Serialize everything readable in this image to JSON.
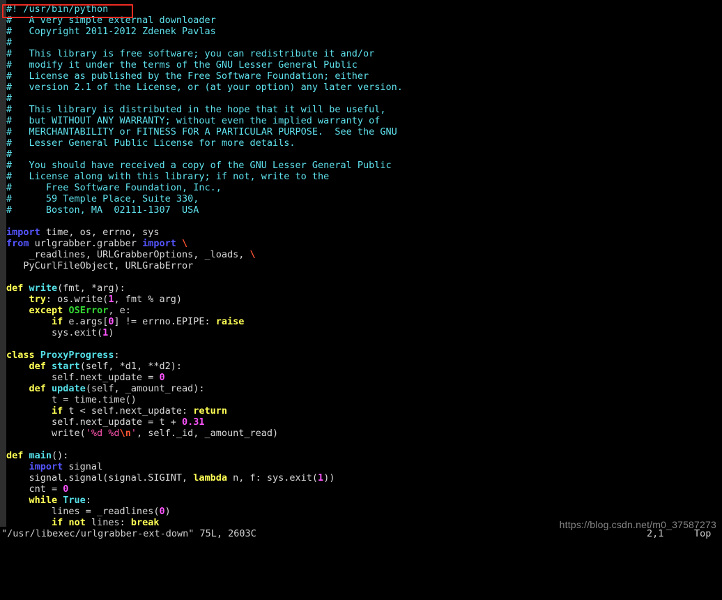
{
  "editor": {
    "name": "vim",
    "background": "#000000",
    "gutter_color": "#2e2e2e"
  },
  "annotation": {
    "shape": "rectangle",
    "color": "#ee2b22",
    "target_line": 1,
    "target_text": "#! /usr/bin/python"
  },
  "watermark": {
    "text": "https://blog.csdn.net/m0_37587273"
  },
  "statusline": {
    "file": "\"/usr/libexec/urlgrabber-ext-down\" 75L, 2603C",
    "position": "2,1",
    "scroll": "Top"
  },
  "code": {
    "lines": [
      [
        {
          "t": "#!",
          "c": "c-comment"
        },
        {
          "t": " /usr/bin/python",
          "c": "c-comment"
        }
      ],
      [
        {
          "t": "#   A very simple external downloader",
          "c": "c-comment"
        }
      ],
      [
        {
          "t": "#   Copyright 2011-2012 Zdenek Pavlas",
          "c": "c-comment"
        }
      ],
      [
        {
          "t": "#",
          "c": "c-comment"
        }
      ],
      [
        {
          "t": "#   This library is free software; you can redistribute it and/or",
          "c": "c-comment"
        }
      ],
      [
        {
          "t": "#   modify it under the terms of the GNU Lesser General Public",
          "c": "c-comment"
        }
      ],
      [
        {
          "t": "#   License as published by the Free Software Foundation; either",
          "c": "c-comment"
        }
      ],
      [
        {
          "t": "#   version 2.1 of the License, or (at your option) any later version.",
          "c": "c-comment"
        }
      ],
      [
        {
          "t": "#",
          "c": "c-comment"
        }
      ],
      [
        {
          "t": "#   This library is distributed in the hope that it will be useful,",
          "c": "c-comment"
        }
      ],
      [
        {
          "t": "#   but WITHOUT ANY WARRANTY; without even the implied warranty of",
          "c": "c-comment"
        }
      ],
      [
        {
          "t": "#   MERCHANTABILITY or FITNESS FOR A PARTICULAR PURPOSE.  See the GNU",
          "c": "c-comment"
        }
      ],
      [
        {
          "t": "#   Lesser General Public License for more details.",
          "c": "c-comment"
        }
      ],
      [
        {
          "t": "#",
          "c": "c-comment"
        }
      ],
      [
        {
          "t": "#   You should have received a copy of the GNU Lesser General Public",
          "c": "c-comment"
        }
      ],
      [
        {
          "t": "#   License along with this library; if not, write to the",
          "c": "c-comment"
        }
      ],
      [
        {
          "t": "#      Free Software Foundation, Inc.,",
          "c": "c-comment"
        }
      ],
      [
        {
          "t": "#      59 Temple Place, Suite 330,",
          "c": "c-comment"
        }
      ],
      [
        {
          "t": "#      Boston, MA  02111-1307  USA",
          "c": "c-comment"
        }
      ],
      [
        {
          "t": "",
          "c": "c-ident"
        }
      ],
      [
        {
          "t": "import",
          "c": "c-pre"
        },
        {
          "t": " time, os, errno, sys",
          "c": "c-ident"
        }
      ],
      [
        {
          "t": "from",
          "c": "c-pre"
        },
        {
          "t": " urlgrabber.grabber ",
          "c": "c-ident"
        },
        {
          "t": "import",
          "c": "c-pre"
        },
        {
          "t": " ",
          "c": "c-ident"
        },
        {
          "t": "\\",
          "c": "c-cont"
        }
      ],
      [
        {
          "t": "    _readlines, URLGrabberOptions, _loads, ",
          "c": "c-ident"
        },
        {
          "t": "\\",
          "c": "c-cont"
        }
      ],
      [
        {
          "t": "   PyCurlFileObject, URLGrabError",
          "c": "c-ident"
        }
      ],
      [
        {
          "t": "",
          "c": "c-ident"
        }
      ],
      [
        {
          "t": "def",
          "c": "c-kw"
        },
        {
          "t": " ",
          "c": "c-ident"
        },
        {
          "t": "write",
          "c": "c-func"
        },
        {
          "t": "(fmt, *arg):",
          "c": "c-ident"
        }
      ],
      [
        {
          "t": "    ",
          "c": "c-ident"
        },
        {
          "t": "try",
          "c": "c-kw"
        },
        {
          "t": ": os.write(",
          "c": "c-ident"
        },
        {
          "t": "1",
          "c": "c-num"
        },
        {
          "t": ", fmt % arg)",
          "c": "c-ident"
        }
      ],
      [
        {
          "t": "    ",
          "c": "c-ident"
        },
        {
          "t": "except",
          "c": "c-kw"
        },
        {
          "t": " ",
          "c": "c-ident"
        },
        {
          "t": "OSError",
          "c": "c-exc"
        },
        {
          "t": ", e:",
          "c": "c-ident"
        }
      ],
      [
        {
          "t": "        ",
          "c": "c-ident"
        },
        {
          "t": "if",
          "c": "c-kw"
        },
        {
          "t": " e.args[",
          "c": "c-ident"
        },
        {
          "t": "0",
          "c": "c-num"
        },
        {
          "t": "] != errno.EPIPE: ",
          "c": "c-ident"
        },
        {
          "t": "raise",
          "c": "c-kw"
        }
      ],
      [
        {
          "t": "        sys.exit(",
          "c": "c-ident"
        },
        {
          "t": "1",
          "c": "c-num"
        },
        {
          "t": ")",
          "c": "c-ident"
        }
      ],
      [
        {
          "t": "",
          "c": "c-ident"
        }
      ],
      [
        {
          "t": "class",
          "c": "c-kw"
        },
        {
          "t": " ",
          "c": "c-ident"
        },
        {
          "t": "ProxyProgress",
          "c": "c-func"
        },
        {
          "t": ":",
          "c": "c-ident"
        }
      ],
      [
        {
          "t": "    ",
          "c": "c-ident"
        },
        {
          "t": "def",
          "c": "c-kw"
        },
        {
          "t": " ",
          "c": "c-ident"
        },
        {
          "t": "start",
          "c": "c-func"
        },
        {
          "t": "(self, *d1, **d2):",
          "c": "c-ident"
        }
      ],
      [
        {
          "t": "        self.next_update = ",
          "c": "c-ident"
        },
        {
          "t": "0",
          "c": "c-num"
        }
      ],
      [
        {
          "t": "    ",
          "c": "c-ident"
        },
        {
          "t": "def",
          "c": "c-kw"
        },
        {
          "t": " ",
          "c": "c-ident"
        },
        {
          "t": "update",
          "c": "c-func"
        },
        {
          "t": "(self, _amount_read):",
          "c": "c-ident"
        }
      ],
      [
        {
          "t": "        t = time.time()",
          "c": "c-ident"
        }
      ],
      [
        {
          "t": "        ",
          "c": "c-ident"
        },
        {
          "t": "if",
          "c": "c-kw"
        },
        {
          "t": " t < self.next_update: ",
          "c": "c-ident"
        },
        {
          "t": "return",
          "c": "c-kw"
        }
      ],
      [
        {
          "t": "        self.next_update = t + ",
          "c": "c-ident"
        },
        {
          "t": "0.31",
          "c": "c-num"
        }
      ],
      [
        {
          "t": "        write(",
          "c": "c-ident"
        },
        {
          "t": "'%d %d",
          "c": "c-str"
        },
        {
          "t": "\\n",
          "c": "c-esc"
        },
        {
          "t": "'",
          "c": "c-str"
        },
        {
          "t": ", self._id, _amount_read)",
          "c": "c-ident"
        }
      ],
      [
        {
          "t": "",
          "c": "c-ident"
        }
      ],
      [
        {
          "t": "def",
          "c": "c-kw"
        },
        {
          "t": " ",
          "c": "c-ident"
        },
        {
          "t": "main",
          "c": "c-func"
        },
        {
          "t": "():",
          "c": "c-ident"
        }
      ],
      [
        {
          "t": "    ",
          "c": "c-ident"
        },
        {
          "t": "import",
          "c": "c-pre"
        },
        {
          "t": " signal",
          "c": "c-ident"
        }
      ],
      [
        {
          "t": "    signal.signal(signal.SIGINT, ",
          "c": "c-ident"
        },
        {
          "t": "lambda",
          "c": "c-kw"
        },
        {
          "t": " n, f: sys.exit(",
          "c": "c-ident"
        },
        {
          "t": "1",
          "c": "c-num"
        },
        {
          "t": "))",
          "c": "c-ident"
        }
      ],
      [
        {
          "t": "    cnt = ",
          "c": "c-ident"
        },
        {
          "t": "0",
          "c": "c-num"
        }
      ],
      [
        {
          "t": "    ",
          "c": "c-ident"
        },
        {
          "t": "while",
          "c": "c-kw"
        },
        {
          "t": " ",
          "c": "c-ident"
        },
        {
          "t": "True",
          "c": "c-bool"
        },
        {
          "t": ":",
          "c": "c-ident"
        }
      ],
      [
        {
          "t": "        lines = _readlines(",
          "c": "c-ident"
        },
        {
          "t": "0",
          "c": "c-num"
        },
        {
          "t": ")",
          "c": "c-ident"
        }
      ],
      [
        {
          "t": "        ",
          "c": "c-ident"
        },
        {
          "t": "if",
          "c": "c-kw"
        },
        {
          "t": " ",
          "c": "c-ident"
        },
        {
          "t": "not",
          "c": "c-kw"
        },
        {
          "t": " lines: ",
          "c": "c-ident"
        },
        {
          "t": "break",
          "c": "c-kw"
        }
      ]
    ]
  }
}
